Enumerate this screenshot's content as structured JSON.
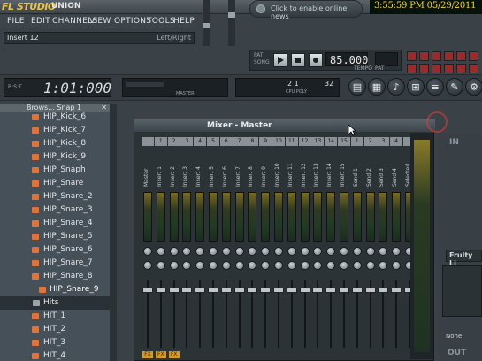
{
  "app": {
    "logo": "FL STUDIO",
    "project": "UNION"
  },
  "menu": [
    "FILE",
    "EDIT",
    "CHANNELS",
    "VIEW",
    "OPTIONS",
    "TOOLS",
    "HELP"
  ],
  "hint": {
    "text": "Insert 12",
    "right": "Left/Right"
  },
  "online": {
    "text": "Click to enable online news"
  },
  "clock": "3:55:59 PM 05/29/2011",
  "transport": {
    "pat": "PAT",
    "song": "SONG",
    "tempo": "85.000",
    "tempo_label": "TEMPO",
    "pattern_label": "PAT"
  },
  "time": {
    "label": "B:S:T",
    "value": "1:01:000"
  },
  "monitor": {
    "label": "MASTER"
  },
  "cpu": {
    "left": "2 1",
    "right": "32",
    "label": "CPU POLY"
  },
  "tools_icons": [
    "playlist-icon",
    "step-sequencer-icon",
    "piano-roll-icon",
    "browser-icon",
    "mixer-icon",
    "plugin-icon",
    "settings-icon"
  ],
  "browser": {
    "title": "Brows... Snap 1",
    "items": [
      {
        "label": "HIP_Kick_6",
        "type": "file"
      },
      {
        "label": "HIP_Kick_7",
        "type": "file"
      },
      {
        "label": "HIP_Kick_8",
        "type": "file"
      },
      {
        "label": "HIP_Kick_9",
        "type": "file"
      },
      {
        "label": "HIP_Snaph",
        "type": "file"
      },
      {
        "label": "HIP_Snare",
        "type": "file"
      },
      {
        "label": "HIP_Snare_2",
        "type": "file"
      },
      {
        "label": "HIP_Snare_3",
        "type": "file"
      },
      {
        "label": "HIP_Snare_4",
        "type": "file"
      },
      {
        "label": "HIP_Snare_5",
        "type": "file"
      },
      {
        "label": "HIP_Snare_6",
        "type": "file"
      },
      {
        "label": "HIP_Snare_7",
        "type": "file"
      },
      {
        "label": "HIP_Snare_8",
        "type": "file"
      },
      {
        "label": "HIP_Snare_9",
        "type": "selected"
      },
      {
        "label": "Hits",
        "type": "folder"
      },
      {
        "label": "HIT_1",
        "type": "file"
      },
      {
        "label": "HIT_2",
        "type": "file"
      },
      {
        "label": "HIT_3",
        "type": "file"
      },
      {
        "label": "HIT_4",
        "type": "file"
      }
    ]
  },
  "mixer": {
    "title": "Mixer - Master",
    "channels": [
      {
        "num": "",
        "name": "Master",
        "fx": "FX"
      },
      {
        "num": "1",
        "name": "Insert 1",
        "fx": "FX"
      },
      {
        "num": "2",
        "name": "Insert 2",
        "fx": "FX"
      },
      {
        "num": "3",
        "name": "Insert 3",
        "fx": ""
      },
      {
        "num": "4",
        "name": "Insert 4",
        "fx": ""
      },
      {
        "num": "5",
        "name": "Insert 5",
        "fx": ""
      },
      {
        "num": "6",
        "name": "Insert 6",
        "fx": ""
      },
      {
        "num": "7",
        "name": "Insert 7",
        "fx": ""
      },
      {
        "num": "8",
        "name": "Insert 8",
        "fx": ""
      },
      {
        "num": "9",
        "name": "Insert 9",
        "fx": ""
      },
      {
        "num": "10",
        "name": "Insert 10",
        "fx": ""
      },
      {
        "num": "11",
        "name": "Insert 11",
        "fx": ""
      },
      {
        "num": "12",
        "name": "Insert 12",
        "fx": ""
      },
      {
        "num": "13",
        "name": "Insert 13",
        "fx": ""
      },
      {
        "num": "14",
        "name": "Insert 14",
        "fx": ""
      },
      {
        "num": "15",
        "name": "Insert 15",
        "fx": ""
      },
      {
        "num": "1",
        "name": "Send 1",
        "fx": ""
      },
      {
        "num": "2",
        "name": "Send 2",
        "fx": ""
      },
      {
        "num": "3",
        "name": "Send 3",
        "fx": ""
      },
      {
        "num": "4",
        "name": "Send 4",
        "fx": ""
      },
      {
        "num": "",
        "name": "Selected",
        "fx": ""
      }
    ]
  },
  "right_panel": {
    "in": "IN",
    "plugin": "Fruity Li",
    "none": "None",
    "out": "OUT"
  },
  "colors": {
    "accent": "#e0733a",
    "clock": "#ffd900",
    "fx": "#d39a22"
  }
}
